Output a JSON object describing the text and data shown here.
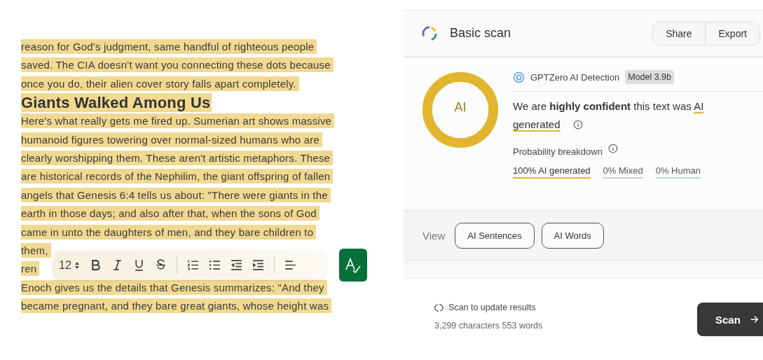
{
  "editor": {
    "blocks": [
      {
        "kind": "para",
        "lines": [
          "reason for God's judgment, same handful of righteous people",
          "saved. The CIA doesn't want you connecting these dots because",
          "once you do, their alien cover story falls apart completely."
        ]
      },
      {
        "kind": "heading",
        "lines": [
          "Giants Walked Among Us"
        ]
      },
      {
        "kind": "para",
        "lines": [
          "Here's what really gets me fired up. Sumerian art shows massive",
          "humanoid figures towering over normal-sized humans who are",
          "clearly worshipping them. These aren't artistic metaphors. These",
          "are historical records of the Nephilim, the giant offspring of fallen",
          "angels that Genesis 6:4 tells us about: \"There were giants in the",
          "earth in those days; and also after that, when the sons of God",
          "came in unto the daughters of men, and they bare children to",
          "them,",
          "ren"
        ]
      },
      {
        "kind": "para",
        "lines": [
          "Enoch gives us the details that Genesis summarizes: \"And they",
          "became pregnant, and they bare great giants, whose height was"
        ]
      }
    ]
  },
  "toolbar": {
    "font_size": "12"
  },
  "scan": {
    "title": "Basic scan",
    "buttons": [
      "Share",
      "Export"
    ]
  },
  "result": {
    "ring_label": "AI",
    "level": 1,
    "detector": "GPTZero AI Detection",
    "model": "Model 3.9b",
    "verdict": "We are **highly confident** this text was",
    "verdict_class": "AI generated",
    "breakdown_title": "Probability breakdown",
    "breakdown": [
      {
        "label": "100% AI generated",
        "color": "#e2b530"
      },
      {
        "label": "0% Mixed",
        "color": "#c9c5e8"
      },
      {
        "label": "0% Human",
        "color": "#b5dccb"
      }
    ]
  },
  "view": {
    "label": "View",
    "buttons": [
      "AI Sentences",
      "AI Words"
    ]
  },
  "footer": {
    "status": "Scan to update results",
    "counts": "3,299 characters 553 words",
    "scan_button": "Scan"
  }
}
